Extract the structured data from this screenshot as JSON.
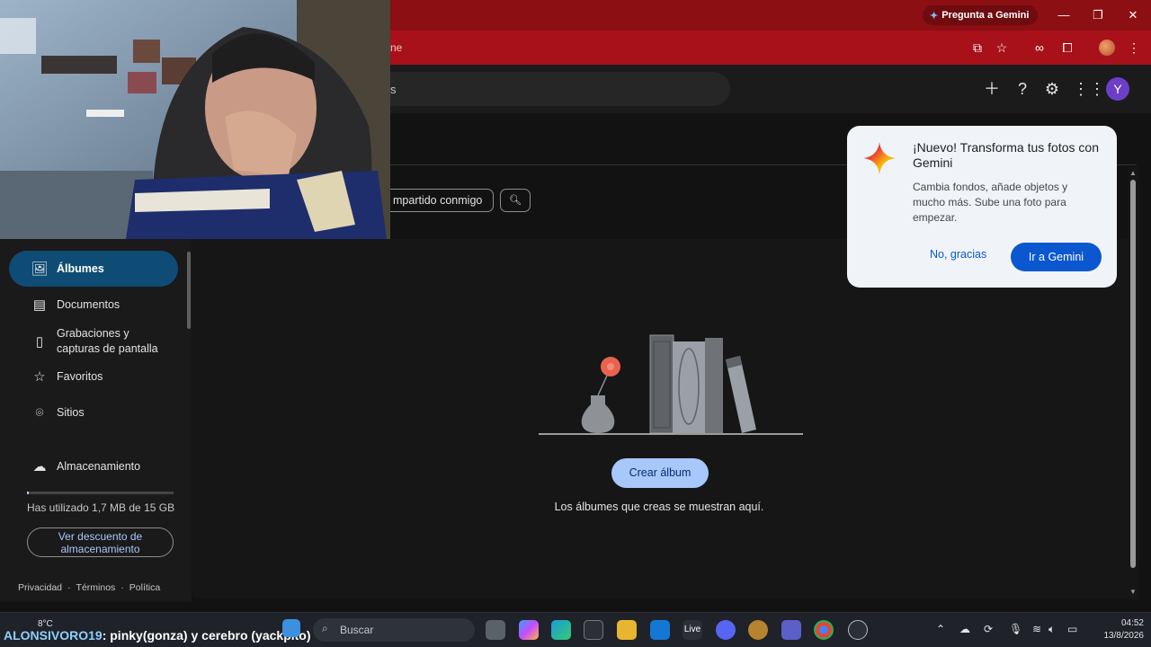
{
  "browser": {
    "gemini_chip": "Pregunta a Gemini",
    "url_fragment": "ne",
    "window_controls": [
      "—",
      "❐",
      "✕"
    ]
  },
  "header": {
    "search_text": "s",
    "avatar_letter": "Y",
    "icons": [
      "plus-icon",
      "help-icon",
      "settings-icon",
      "apps-grid-icon"
    ]
  },
  "chips": {
    "shared": "mpartido conmigo"
  },
  "sidebar": {
    "items": [
      {
        "label": "Álbumes",
        "icon": "album-icon",
        "active": true
      },
      {
        "label": "Documentos",
        "icon": "document-icon"
      },
      {
        "label": "Grabaciones y capturas de pantalla",
        "icon": "phone-icon"
      },
      {
        "label": "Favoritos",
        "icon": "star-icon"
      },
      {
        "label": "Sitios",
        "icon": "location-icon"
      },
      {
        "label": "Almacenamiento",
        "icon": "cloud-icon"
      }
    ],
    "storage_text": "Has utilizado 1,7 MB de 15 GB",
    "storage_used_fraction": 0.0001,
    "storage_button": "Ver descuento de almacenamiento",
    "footer": [
      "Privacidad",
      "·",
      "Términos",
      "·",
      "Política"
    ]
  },
  "main": {
    "create_button": "Crear álbum",
    "empty_text": "Los álbumes que creas se muestran aquí."
  },
  "gemini_popup": {
    "title": "¡Nuevo! Transforma tus fotos con Gemini",
    "body": "Cambia fondos, añade objetos y mucho más. Sube una foto para empezar.",
    "dismiss": "No, gracias",
    "confirm": "Ir a Gemini"
  },
  "taskbar": {
    "temperature": "8°C",
    "overlay_user": "ALONSIVORO19",
    "overlay_message": ": pinky(gonza) y cerebro (yackpito)",
    "search_placeholder": "Buscar",
    "time": "04:52",
    "date": "13/8/2026",
    "edge_label": "Live"
  },
  "colors": {
    "chrome_red": "#a8111a",
    "accent_blue": "#a8c7fa",
    "gemini_blue": "#0b57d0",
    "avatar_purple": "#6b3fc7"
  }
}
